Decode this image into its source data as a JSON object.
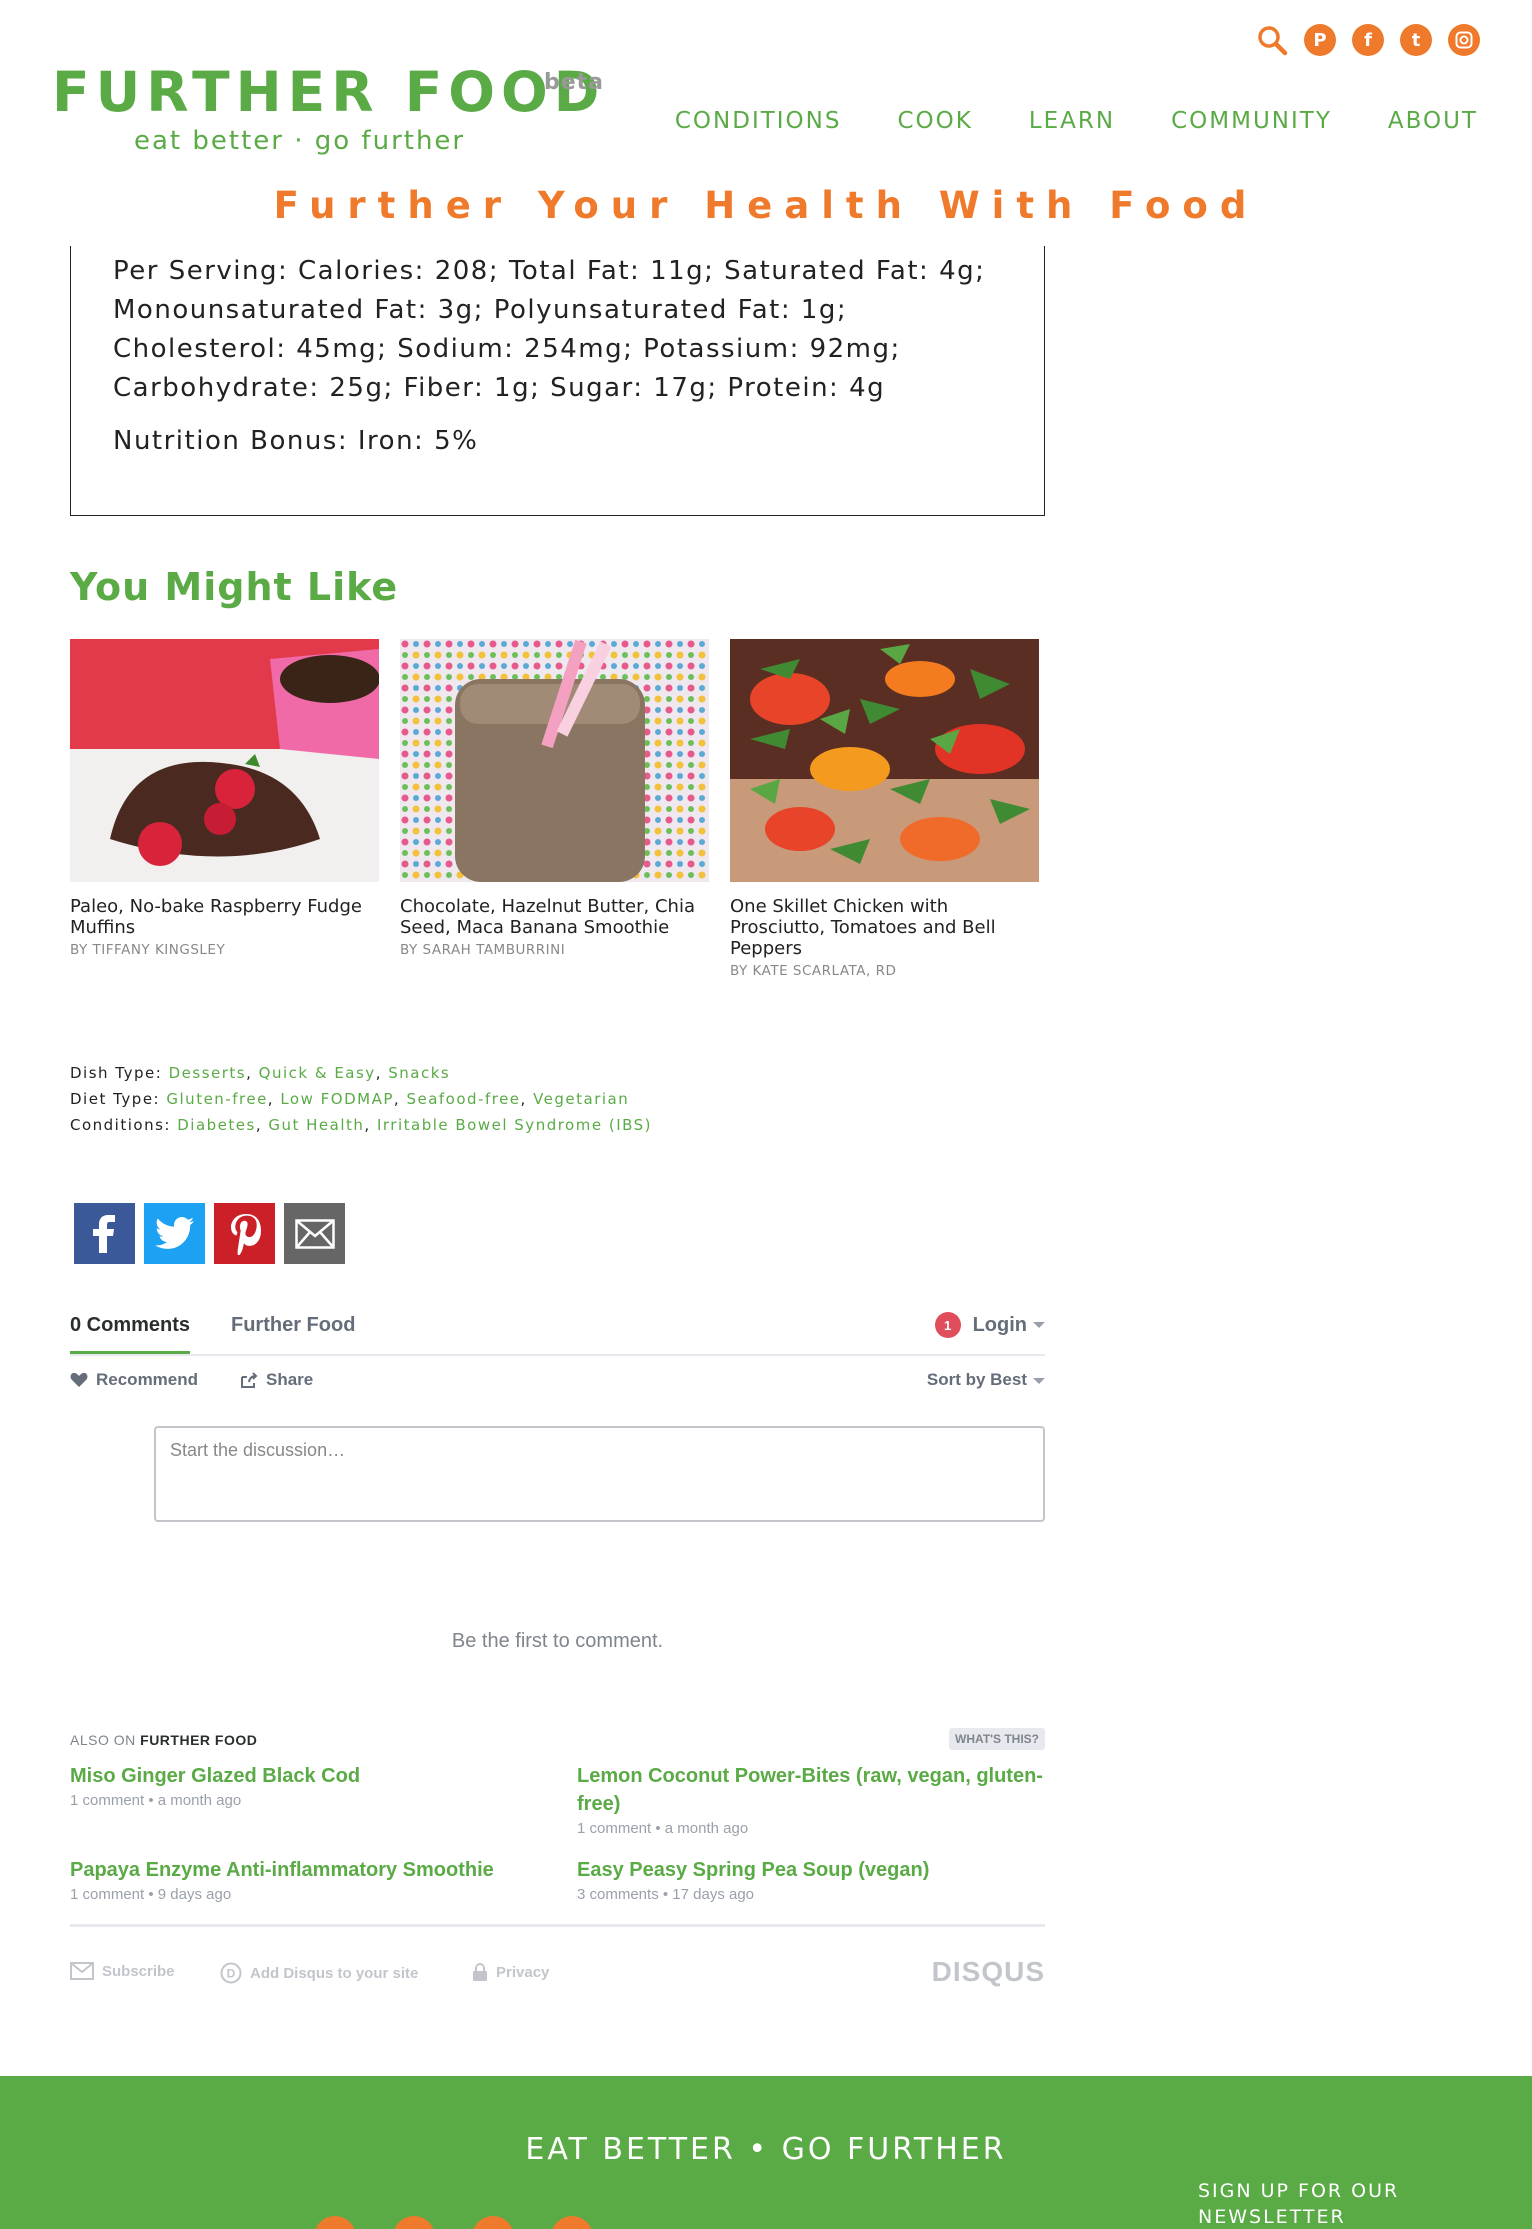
{
  "header": {
    "logo": "FURTHER FOOD",
    "beta": "beta",
    "tagline": "eat better · go further",
    "nav": [
      "CONDITIONS",
      "COOK",
      "LEARN",
      "COMMUNITY",
      "ABOUT"
    ],
    "social_icons": [
      "search-icon",
      "pinterest-icon",
      "facebook-icon",
      "twitter-icon",
      "instagram-icon"
    ],
    "slogan": "Further Your Health With Food"
  },
  "nutrition": {
    "per_serving": "Per Serving:  Calories: 208; Total Fat: 11g; Saturated Fat: 4g; Monounsaturated Fat: 3g; Polyunsaturated Fat: 1g; Cholesterol: 45mg; Sodium: 254mg; Potassium: 92mg; Carbohydrate: 25g; Fiber: 1g; Sugar: 17g; Protein: 4g",
    "bonus": "Nutrition Bonus:   Iron: 5%"
  },
  "you_might_like": {
    "title": "You Might Like",
    "cards": [
      {
        "title": "Paleo, No-bake Raspberry Fudge Muffins",
        "author": "BY TIFFANY KINGSLEY"
      },
      {
        "title": "Chocolate, Hazelnut Butter, Chia Seed, Maca Banana Smoothie",
        "author": "BY SARAH TAMBURRINI"
      },
      {
        "title": "One Skillet Chicken with Prosciutto, Tomatoes and Bell Peppers",
        "author": "BY KATE SCARLATA, RD"
      }
    ]
  },
  "tags": {
    "dish_label": "Dish Type:",
    "dish": [
      "Desserts",
      "Quick & Easy",
      "Snacks"
    ],
    "diet_label": "Diet Type:",
    "diet": [
      "Gluten-free",
      "Low FODMAP",
      "Seafood-free",
      "Vegetarian"
    ],
    "conditions_label": "Conditions:",
    "conditions": [
      "Diabetes",
      "Gut Health",
      "Irritable Bowel Syndrome (IBS)"
    ]
  },
  "share": [
    "facebook-icon",
    "twitter-icon",
    "pinterest-icon",
    "email-icon"
  ],
  "disqus": {
    "comments_tab": "0 Comments",
    "site_tab": "Further Food",
    "badge": "1",
    "login": "Login",
    "recommend": "Recommend",
    "share": "Share",
    "sort": "Sort by Best",
    "placeholder": "Start the discussion…",
    "first": "Be the first to comment.",
    "also_on": "ALSO ON",
    "also_site": "FURTHER FOOD",
    "whats_this": "WHAT'S THIS?",
    "also_items": [
      {
        "title": "Miso Ginger Glazed Black Cod",
        "meta": "1 comment • a month ago"
      },
      {
        "title": "Lemon Coconut Power-Bites (raw, vegan, gluten-free)",
        "meta": "1 comment • a month ago"
      },
      {
        "title": "Papaya Enzyme Anti-inflammatory Smoothie",
        "meta": "1 comment • 9 days ago"
      },
      {
        "title": "Easy Peasy Spring Pea Soup (vegan)",
        "meta": "3 comments • 17 days ago"
      }
    ],
    "subscribe": "Subscribe",
    "add_disqus": "Add Disqus to your site",
    "privacy": "Privacy",
    "logo": "DISQUS"
  },
  "footer": {
    "tagline": "EAT BETTER • GO FURTHER",
    "newsletter": "SIGN UP FOR OUR NEWSLETTER"
  },
  "colors": {
    "brand_green": "#5aaa46",
    "brand_orange": "#f07a2b"
  }
}
